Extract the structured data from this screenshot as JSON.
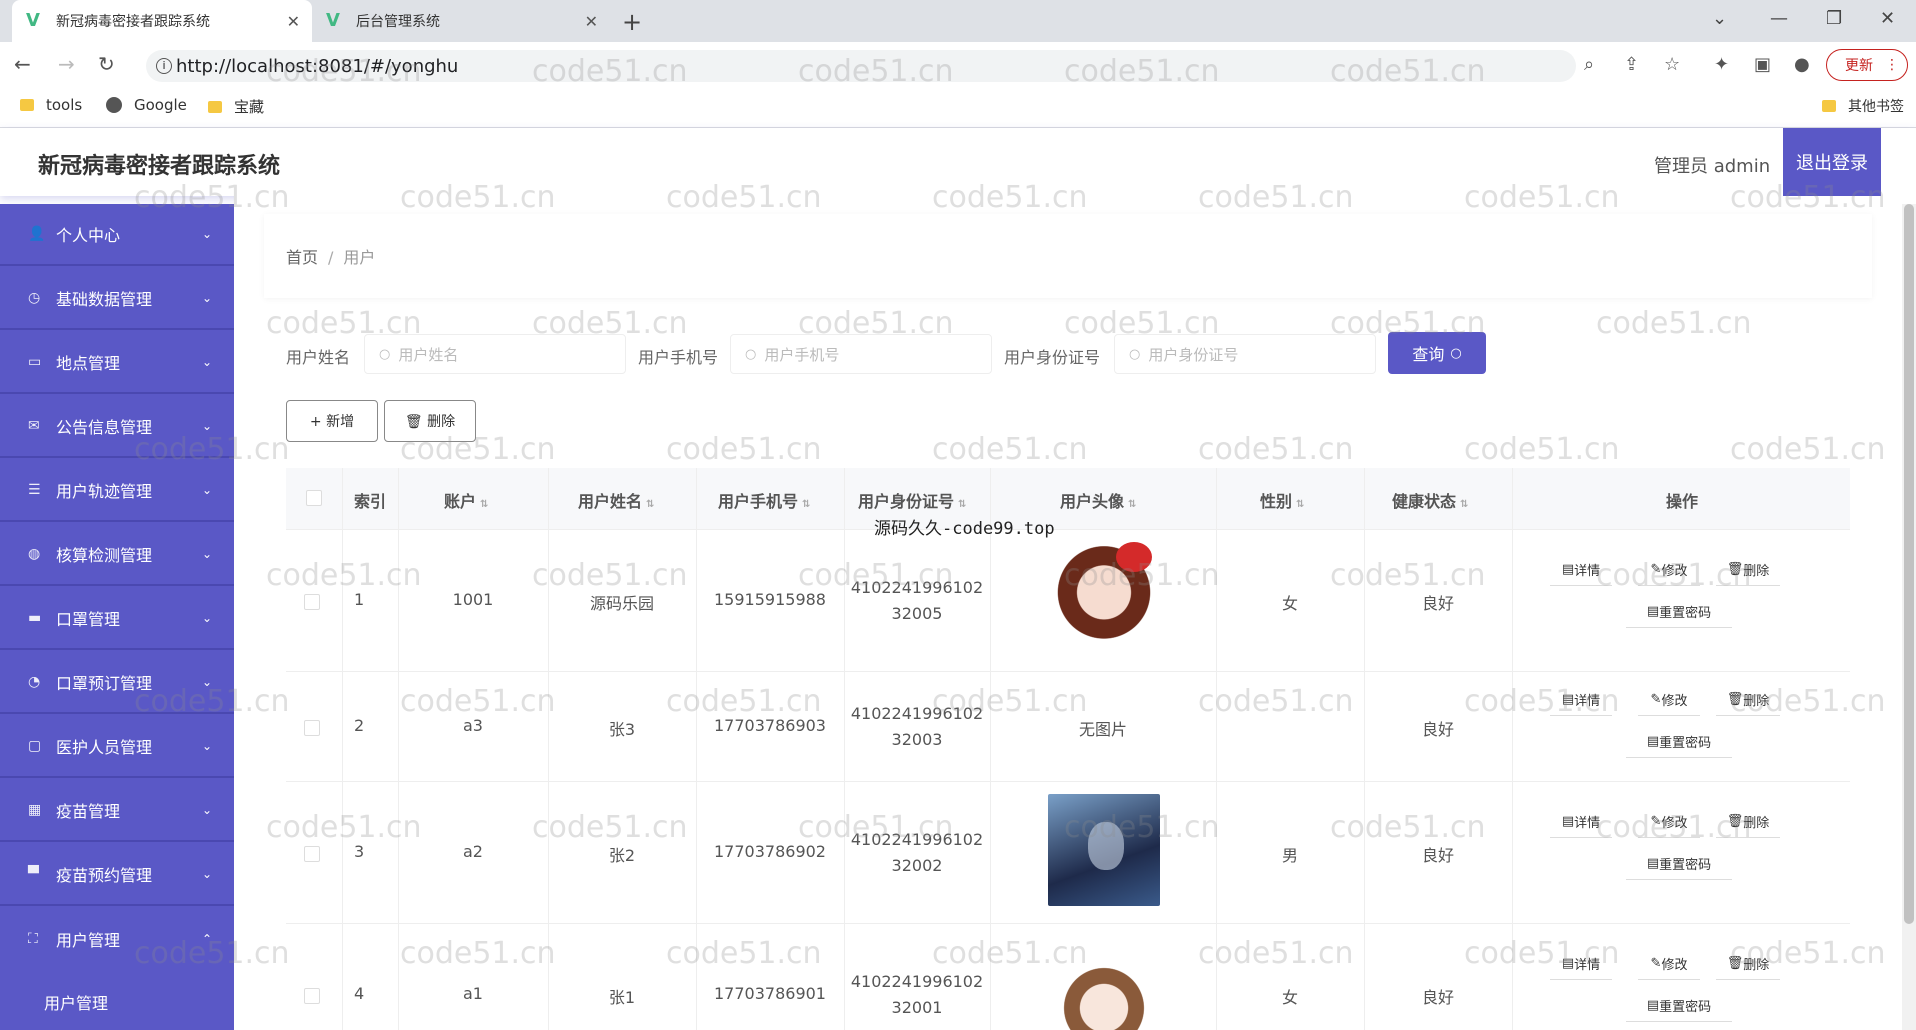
{
  "browser": {
    "tabs": [
      {
        "title": "新冠病毒密接者跟踪系统",
        "active": true
      },
      {
        "title": "后台管理系统",
        "active": false
      }
    ],
    "url": "http://localhost:8081/#/yonghu",
    "update_label": "更新",
    "bookmarks": [
      "tools",
      "Google",
      "宝藏"
    ],
    "other_bookmarks": "其他书签"
  },
  "header": {
    "title": "新冠病毒密接者跟踪系统",
    "user": "管理员 admin",
    "logout": "退出登录"
  },
  "sidebar": {
    "items": [
      {
        "label": "个人中心",
        "icon": "user-icon",
        "glyph": "👤"
      },
      {
        "label": "基础数据管理",
        "icon": "clock-icon",
        "glyph": "◷"
      },
      {
        "label": "地点管理",
        "icon": "card-icon",
        "glyph": "▭"
      },
      {
        "label": "公告信息管理",
        "icon": "mail-icon",
        "glyph": "✉"
      },
      {
        "label": "用户轨迹管理",
        "icon": "list-icon",
        "glyph": "☰"
      },
      {
        "label": "核算检测管理",
        "icon": "globe-icon",
        "glyph": "◍"
      },
      {
        "label": "口罩管理",
        "icon": "mask-icon",
        "glyph": "▬"
      },
      {
        "label": "口罩预订管理",
        "icon": "compass-icon",
        "glyph": "◔"
      },
      {
        "label": "医护人员管理",
        "icon": "chat-icon",
        "glyph": "▢"
      },
      {
        "label": "疫苗管理",
        "icon": "grid-icon",
        "glyph": "▦"
      },
      {
        "label": "疫苗预约管理",
        "icon": "monitor-icon",
        "glyph": "▀"
      },
      {
        "label": "用户管理",
        "icon": "frame-icon",
        "glyph": "⛶"
      }
    ],
    "sub_item": "用户管理"
  },
  "breadcrumb": {
    "home": "首页",
    "current": "用户"
  },
  "search": {
    "fields": [
      {
        "label": "用户姓名",
        "placeholder": "用户姓名"
      },
      {
        "label": "用户手机号",
        "placeholder": "用户手机号"
      },
      {
        "label": "用户身份证号",
        "placeholder": "用户身份证号"
      }
    ],
    "query_button": "查询"
  },
  "actions": {
    "add": "+ 新增",
    "delete": "🗑 删除"
  },
  "table": {
    "columns": [
      "索引",
      "账户",
      "用户姓名",
      "用户手机号",
      "用户身份证号",
      "用户头像",
      "性别",
      "健康状态",
      "操作"
    ],
    "rows": [
      {
        "index": "1",
        "account": "1001",
        "name": "源码乐园",
        "phone": "15915915988",
        "id1": "4102241996102",
        "id2": "32005",
        "avatar": "",
        "gender": "女",
        "health": "良好"
      },
      {
        "index": "2",
        "account": "a3",
        "name": "张3",
        "phone": "17703786903",
        "id1": "4102241996102",
        "id2": "32003",
        "avatar": "无图片",
        "gender": "",
        "health": "良好"
      },
      {
        "index": "3",
        "account": "a2",
        "name": "张2",
        "phone": "17703786902",
        "id1": "4102241996102",
        "id2": "32002",
        "avatar": "",
        "gender": "男",
        "health": "良好"
      },
      {
        "index": "4",
        "account": "a1",
        "name": "张1",
        "phone": "17703786901",
        "id1": "4102241996102",
        "id2": "32001",
        "avatar": "",
        "gender": "女",
        "health": "良好"
      }
    ],
    "ops": {
      "detail": "详情",
      "edit": "修改",
      "delete": "删除",
      "reset": "重置密码"
    }
  },
  "overlay": "源码久久-code99.top",
  "watermark": "code51.cn",
  "colors": {
    "primary": "#5a58c6"
  }
}
